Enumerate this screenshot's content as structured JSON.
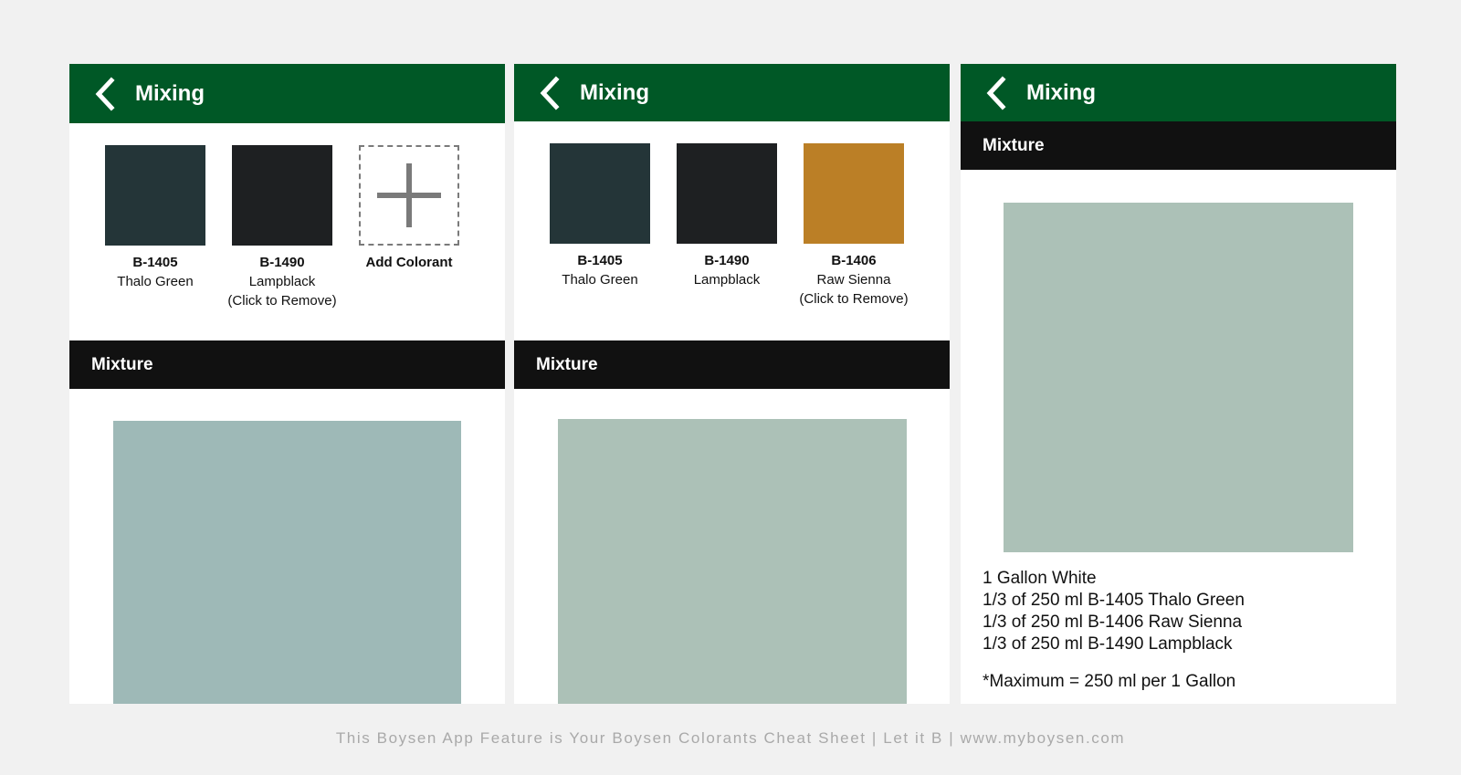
{
  "colors": {
    "appbar": "#005826",
    "section_bar": "#111111",
    "background": "#f1f1f1"
  },
  "panels": [
    {
      "title": "Mixing",
      "colorants": [
        {
          "code": "B-1405",
          "name": "Thalo Green",
          "note": "",
          "color": "#243538"
        },
        {
          "code": "B-1490",
          "name": "Lampblack",
          "note": "(Click to Remove)",
          "color": "#1e2022"
        }
      ],
      "add_label": "Add Colorant",
      "section_label": "Mixture",
      "mixture_color": "#9eb9b7"
    },
    {
      "title": "Mixing",
      "colorants": [
        {
          "code": "B-1405",
          "name": "Thalo Green",
          "note": "",
          "color": "#243538"
        },
        {
          "code": "B-1490",
          "name": "Lampblack",
          "note": "",
          "color": "#1e2022"
        },
        {
          "code": "B-1406",
          "name": "Raw Sienna",
          "note": "(Click to Remove)",
          "color": "#bb7f26"
        }
      ],
      "section_label": "Mixture",
      "mixture_color": "#acc1b7"
    },
    {
      "title": "Mixing",
      "section_label": "Mixture",
      "mixture_color": "#acc1b7",
      "recipe_lines": [
        "1 Gallon White",
        "1/3 of 250 ml B-1405 Thalo Green",
        "1/3 of 250 ml B-1406 Raw Sienna",
        "1/3 of 250 ml B-1490 Lampblack"
      ],
      "max_note": "*Maximum = 250 ml per 1 Gallon"
    }
  ],
  "footer": "This Boysen App Feature is Your Boysen Colorants Cheat Sheet | Let it B | www.myboysen.com",
  "icons": {
    "back": "chevron-left-icon",
    "add": "plus-icon"
  }
}
